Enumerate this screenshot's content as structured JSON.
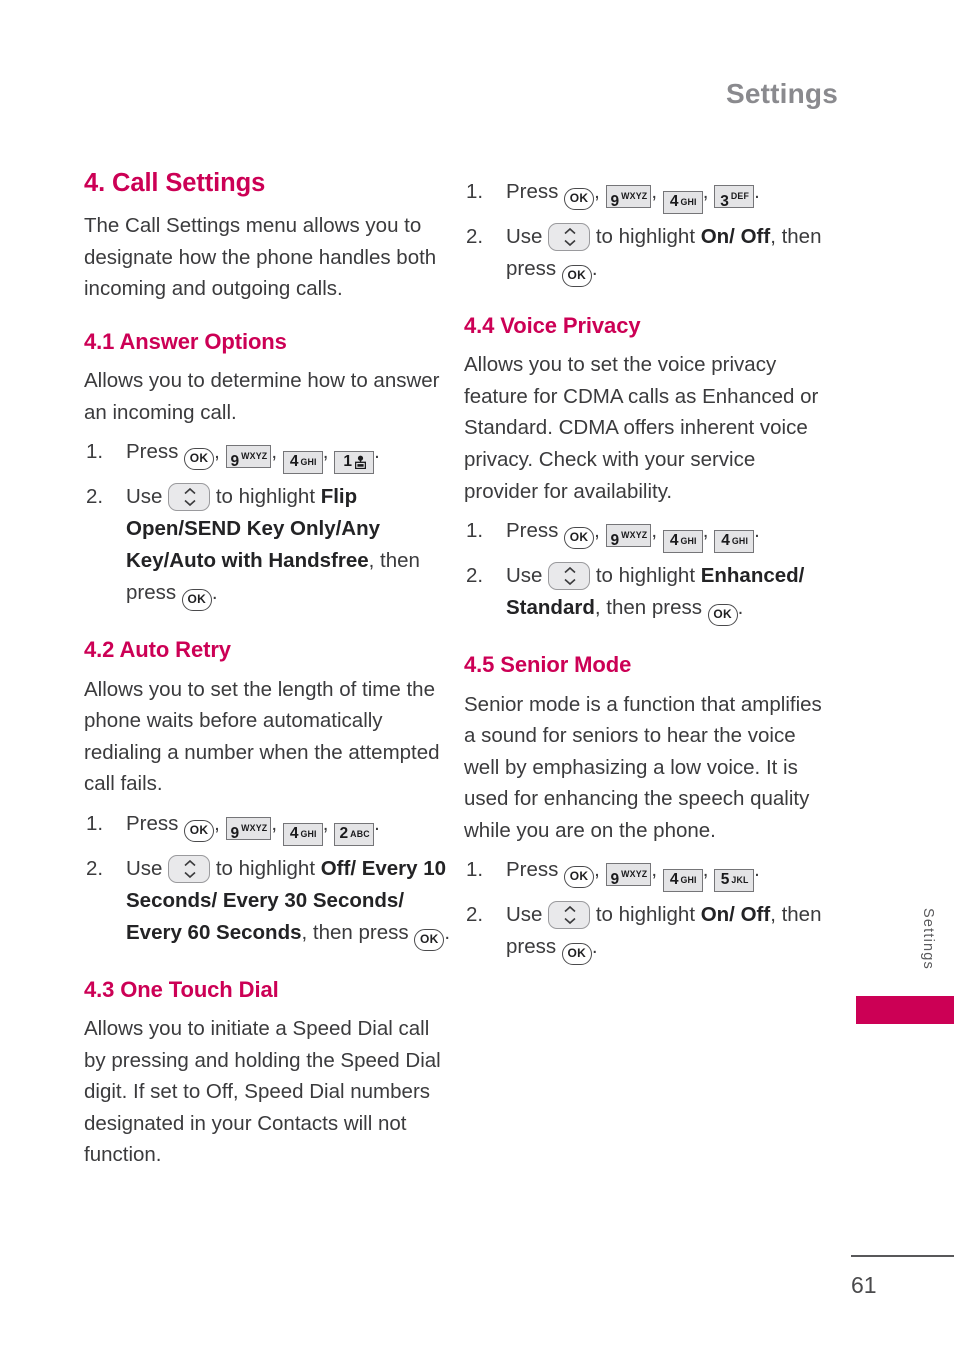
{
  "header": {
    "title": "Settings"
  },
  "side_tab": {
    "label": "Settings",
    "color": "#cc0055"
  },
  "footer": {
    "page_number": "61"
  },
  "theme": {
    "accent": "#cc0055",
    "body_text": "#3b3b3d",
    "key_fill": "#e4e4e6"
  },
  "keys": {
    "ok": "OK",
    "nine": {
      "digit": "9",
      "letters": "WXYZ"
    },
    "four": {
      "digit": "4",
      "letters": "GHI"
    },
    "one": {
      "digit": "1",
      "letters": ""
    },
    "two": {
      "digit": "2",
      "letters": "ABC"
    },
    "three": {
      "digit": "3",
      "letters": "DEF"
    },
    "five": {
      "digit": "5",
      "letters": "JKL"
    },
    "nav": "navigation-up-down"
  },
  "left_column": {
    "section_title": "4. Call Settings",
    "section_intro": "The Call Settings menu allows you to designate how the phone handles both incoming and outgoing calls.",
    "subsections": [
      {
        "title": "4.1 Answer Options",
        "body": "Allows you to determine how to answer an incoming call.",
        "steps": [
          {
            "prefix": "Press ",
            "keys": [
              "ok",
              "nine",
              "four",
              "one"
            ],
            "suffix": "."
          },
          {
            "prefix": "Use ",
            "keys": [
              "nav"
            ],
            "mid": " to highlight ",
            "option": "Flip Open/SEND Key Only/Any Key/Auto with Handsfree",
            "after": ", then press ",
            "end_key": "ok",
            "suffix": "."
          }
        ]
      },
      {
        "title": "4.2 Auto Retry",
        "body": "Allows you to set the length of time the phone waits before automatically redialing a number when the attempted call fails.",
        "steps": [
          {
            "prefix": "Press ",
            "keys": [
              "ok",
              "nine",
              "four",
              "two"
            ],
            "suffix": "."
          },
          {
            "prefix": "Use ",
            "keys": [
              "nav"
            ],
            "mid": " to highlight ",
            "option": "Off/ Every 10 Seconds/ Every 30 Seconds/ Every 60 Seconds",
            "after": ", then press ",
            "end_key": "ok",
            "suffix": "."
          }
        ]
      },
      {
        "title": "4.3 One Touch Dial",
        "body": "Allows you to initiate a Speed Dial call by pressing and holding the Speed Dial digit. If set to Off, Speed Dial numbers designated in your Contacts will not function.",
        "steps": []
      }
    ]
  },
  "right_column": {
    "top_steps": [
      {
        "prefix": "Press ",
        "keys": [
          "ok",
          "nine",
          "four",
          "three"
        ],
        "suffix": "."
      },
      {
        "prefix": "Use ",
        "keys": [
          "nav"
        ],
        "mid": " to highlight ",
        "option": "On/ Off",
        "after": ", then press ",
        "end_key": "ok",
        "suffix": "."
      }
    ],
    "subsections": [
      {
        "title": "4.4 Voice Privacy",
        "body": "Allows you to set the voice privacy feature for CDMA calls as Enhanced or Standard. CDMA offers inherent voice privacy. Check with your service provider for availability.",
        "steps": [
          {
            "prefix": "Press ",
            "keys": [
              "ok",
              "nine",
              "four",
              "four"
            ],
            "suffix": "."
          },
          {
            "prefix": "Use ",
            "keys": [
              "nav"
            ],
            "mid": " to highlight ",
            "option": "Enhanced/ Standard",
            "after": ", then press ",
            "end_key": "ok",
            "suffix": "."
          }
        ]
      },
      {
        "title": "4.5 Senior Mode",
        "body": "Senior mode is a function that amplifies a sound for seniors to hear the voice well by emphasizing a low voice. It is used for enhancing the speech quality while you are on the phone.",
        "steps": [
          {
            "prefix": "Press ",
            "keys": [
              "ok",
              "nine",
              "four",
              "five"
            ],
            "suffix": "."
          },
          {
            "prefix": "Use ",
            "keys": [
              "nav"
            ],
            "mid": " to highlight ",
            "option": "On/ Off",
            "after": ", then press ",
            "end_key": "ok",
            "suffix": "."
          }
        ]
      }
    ]
  }
}
